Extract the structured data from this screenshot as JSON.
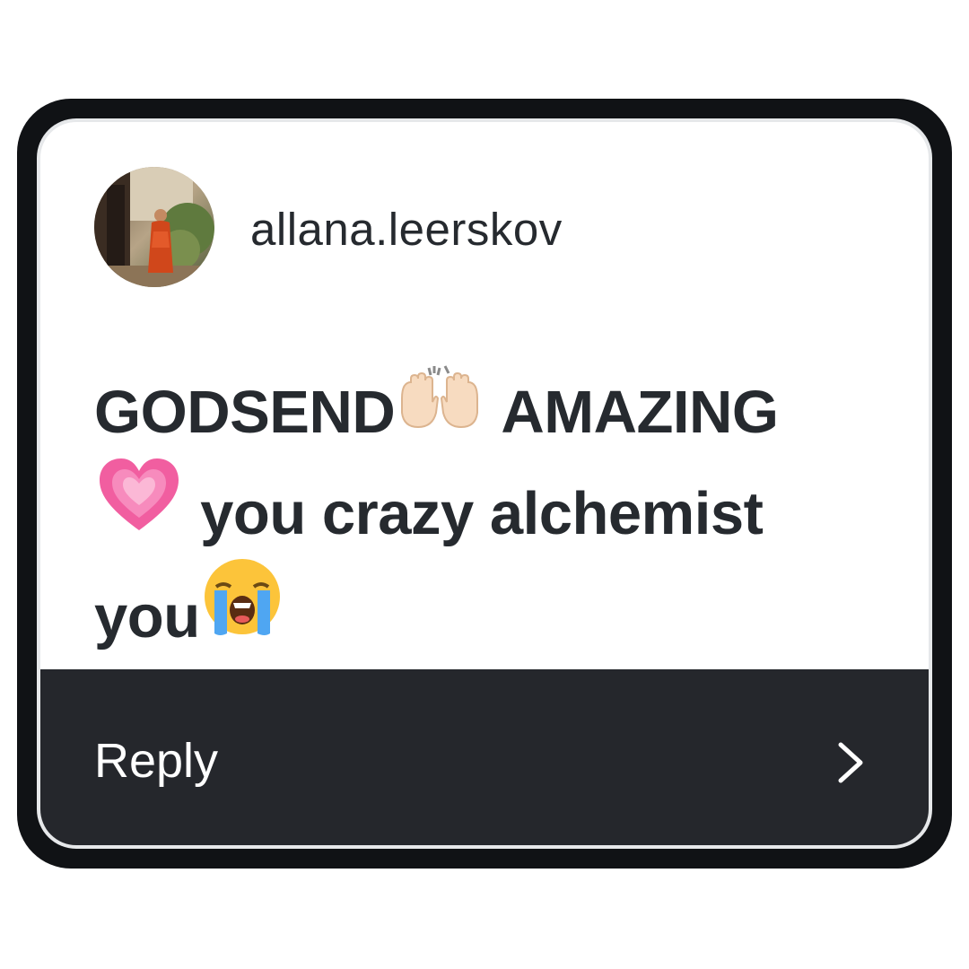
{
  "comment_card": {
    "username": "allana.leerskov",
    "comment": {
      "part1": "GODSEND",
      "part2": "AMAZING",
      "part3": "you crazy alchemist",
      "part4": "you"
    },
    "emojis": [
      "raising-hands-emoji",
      "growing-heart-emoji",
      "crying-face-emoji"
    ],
    "reply_label": "Reply"
  },
  "colors": {
    "frame": "#101215",
    "reply_bar": "#25272c",
    "text": "#262a2f",
    "background": "#ffffff"
  }
}
